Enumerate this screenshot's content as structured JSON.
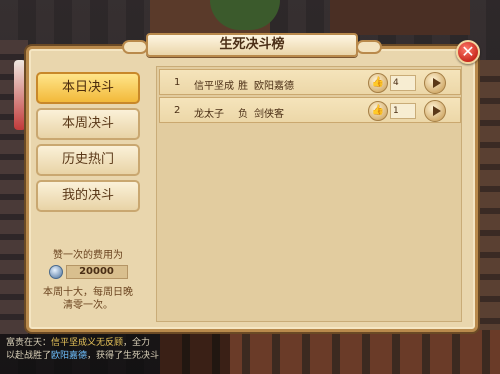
{
  "panel": {
    "title": "生死决斗榜",
    "close_icon": "close-icon"
  },
  "tabs": [
    {
      "label": "本日决斗",
      "active": true
    },
    {
      "label": "本周决斗",
      "active": false
    },
    {
      "label": "历史热门",
      "active": false
    },
    {
      "label": "我的决斗",
      "active": false
    }
  ],
  "cost": {
    "label": "赞一次的费用为",
    "value": "20000",
    "note_line1": "本周十大，每周日晚",
    "note_line2": "清零一次。"
  },
  "duels": [
    {
      "rank": "1",
      "player1": "信平坚成",
      "result": "胜",
      "player2": "欧阳嘉德",
      "likes": "4"
    },
    {
      "rank": "2",
      "player1": "龙太子",
      "result": "负",
      "player2": "剑侠客",
      "likes": "1"
    }
  ],
  "chat": {
    "line1_prefix": "富贵在天：",
    "line1_highlight": "信平坚成义无反顾",
    "line1_suffix": "，全力",
    "line2_prefix": "以赴战胜了",
    "line2_link": "欧阳嘉德",
    "line2_suffix": "，获得了生死决斗"
  },
  "colors": {
    "active_tab": "#f2b93a",
    "panel_bg": "#e9d6ad",
    "close_button": "#c92a1e"
  }
}
